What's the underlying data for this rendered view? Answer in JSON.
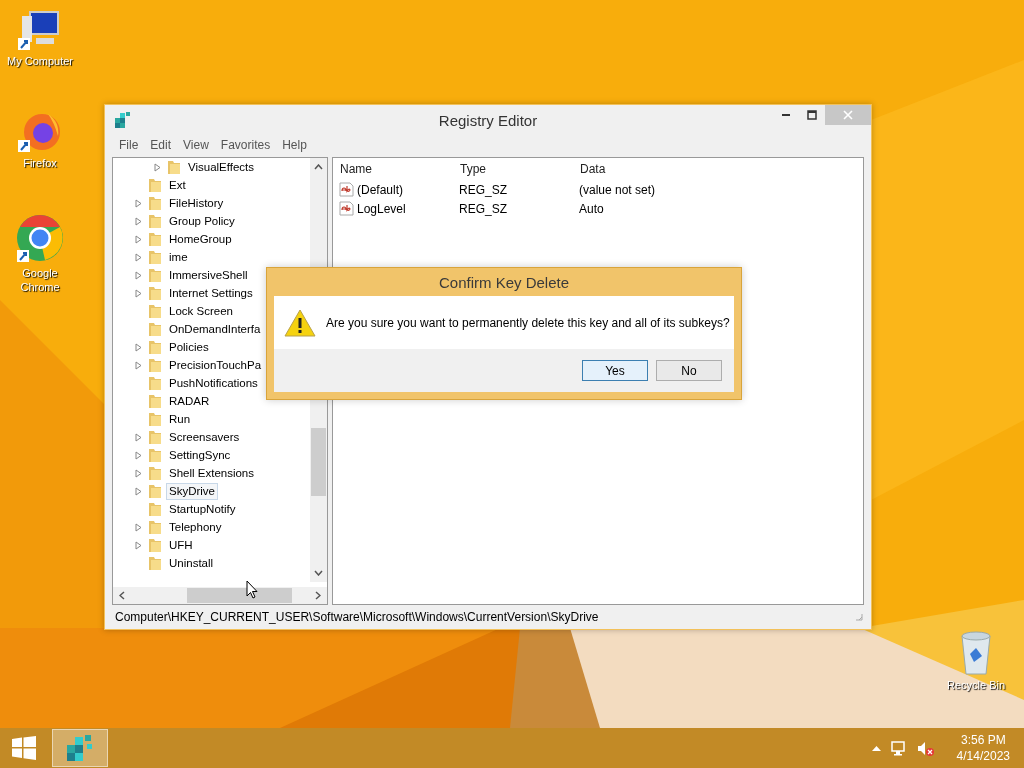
{
  "desktop_icons": [
    {
      "label": "My Computer",
      "kind": "computer"
    },
    {
      "label": "Firefox",
      "kind": "firefox"
    },
    {
      "label": "Google Chrome",
      "kind": "chrome"
    },
    {
      "label": "Recycle Bin",
      "kind": "bin"
    }
  ],
  "window": {
    "title": "Registry Editor",
    "menu": [
      "File",
      "Edit",
      "View",
      "Favorites",
      "Help"
    ],
    "tree": [
      {
        "children": [
          {
            "label": "VisualEffects",
            "expandable": true,
            "selected": false
          }
        ]
      },
      {
        "label": "Ext",
        "expandable": false,
        "selected": false
      },
      {
        "label": "FileHistory",
        "expandable": true,
        "selected": false
      },
      {
        "label": "Group Policy",
        "expandable": true,
        "selected": false
      },
      {
        "label": "HomeGroup",
        "expandable": true,
        "selected": false
      },
      {
        "label": "ime",
        "expandable": true,
        "selected": false
      },
      {
        "label": "ImmersiveShell",
        "expandable": true,
        "selected": false
      },
      {
        "label": "Internet Settings",
        "expandable": true,
        "selected": false
      },
      {
        "label": "Lock Screen",
        "expandable": false,
        "selected": false
      },
      {
        "label": "OnDemandInterfa",
        "expandable": false,
        "selected": false
      },
      {
        "label": "Policies",
        "expandable": true,
        "selected": false
      },
      {
        "label": "PrecisionTouchPa",
        "expandable": true,
        "selected": false
      },
      {
        "label": "PushNotifications",
        "expandable": false,
        "selected": false
      },
      {
        "label": "RADAR",
        "expandable": false,
        "selected": false
      },
      {
        "label": "Run",
        "expandable": false,
        "selected": false
      },
      {
        "label": "Screensavers",
        "expandable": true,
        "selected": false
      },
      {
        "label": "SettingSync",
        "expandable": true,
        "selected": false
      },
      {
        "label": "Shell Extensions",
        "expandable": true,
        "selected": false
      },
      {
        "label": "SkyDrive",
        "expandable": true,
        "selected": true
      },
      {
        "label": "StartupNotify",
        "expandable": false,
        "selected": false
      },
      {
        "label": "Telephony",
        "expandable": true,
        "selected": false
      },
      {
        "label": "UFH",
        "expandable": true,
        "selected": false
      },
      {
        "label": "Uninstall",
        "expandable": false,
        "selected": false
      }
    ],
    "values": {
      "columns": [
        "Name",
        "Type",
        "Data"
      ],
      "rows": [
        {
          "name": "(Default)",
          "type": "REG_SZ",
          "data": "(value not set)"
        },
        {
          "name": "LogLevel",
          "type": "REG_SZ",
          "data": "Auto"
        }
      ]
    },
    "status_bar": "Computer\\HKEY_CURRENT_USER\\Software\\Microsoft\\Windows\\CurrentVersion\\SkyDrive"
  },
  "dialog": {
    "title": "Confirm Key Delete",
    "message": "Are you sure you want to permanently delete this key and all of its subkeys?",
    "buttons": [
      {
        "label": "Yes",
        "default": true
      },
      {
        "label": "No",
        "default": false
      }
    ]
  },
  "taskbar": {
    "time": "3:56 PM",
    "date": "4/14/2023"
  }
}
